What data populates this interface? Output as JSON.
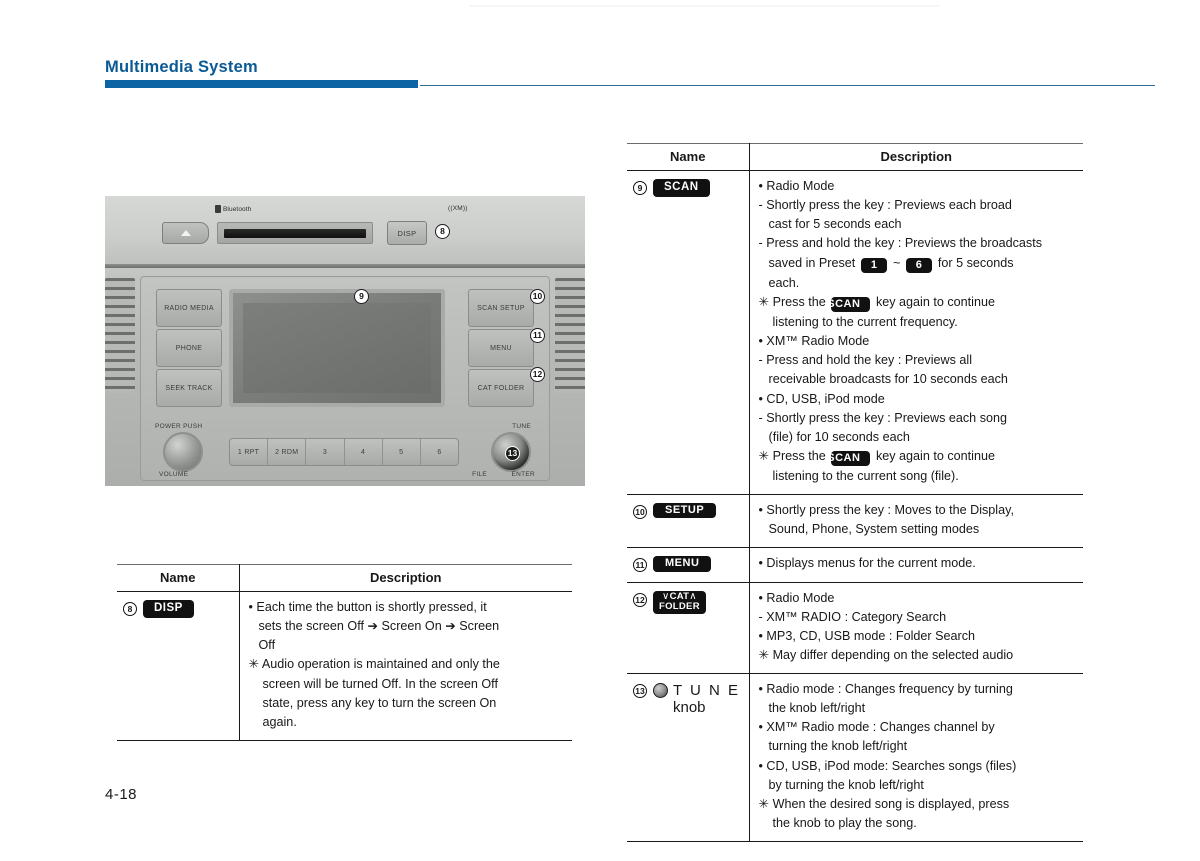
{
  "header": {
    "title": "Multimedia System"
  },
  "footer": {
    "page_number": "4-18"
  },
  "radio_photo": {
    "alt": "car-audio-head-unit-photo",
    "bluetooth_label": "Bluetooth",
    "xm_label": "((XM))",
    "eject_label": "eject-triangle",
    "disp_label": "DISP",
    "left_buttons": [
      "RADIO MEDIA",
      "PHONE",
      "SEEK TRACK"
    ],
    "right_buttons": [
      "SCAN SETUP",
      "MENU",
      "CAT FOLDER"
    ],
    "presets": [
      "1 RPT",
      "2 RDM",
      "3",
      "4",
      "5",
      "6"
    ],
    "power_label": "POWER PUSH",
    "volume_label": "VOLUME",
    "tune_label": "TUNE",
    "file_label": "FILE",
    "enter_label": "ENTER",
    "callouts": [
      "8",
      "9",
      "10",
      "11",
      "12",
      "13"
    ]
  },
  "table_left": {
    "columns": {
      "name": "Name",
      "description": "Description"
    },
    "rows": [
      {
        "num": "8",
        "badge": "DISP",
        "lines": [
          {
            "kind": "bullet",
            "text": "Each time the button is shortly pressed, it"
          },
          {
            "kind": "cont",
            "text": "sets the screen Off ➔ Screen On ➔ Screen"
          },
          {
            "kind": "cont",
            "text": "Off"
          },
          {
            "kind": "star",
            "text": "Audio operation is maintained and only the"
          },
          {
            "kind": "cont2",
            "text": "screen will be turned Off. In the screen Off"
          },
          {
            "kind": "cont2",
            "text": "state, press any key to turn the screen On"
          },
          {
            "kind": "cont2",
            "text": "again."
          }
        ]
      }
    ]
  },
  "table_right": {
    "columns": {
      "name": "Name",
      "description": "Description"
    },
    "rows": [
      {
        "num": "9",
        "badge": "SCAN",
        "lines": [
          {
            "kind": "bullet",
            "text": "Radio Mode"
          },
          {
            "kind": "dash",
            "text": "Shortly press the key : Previews each broad"
          },
          {
            "kind": "cont",
            "text": "cast for 5 seconds each"
          },
          {
            "kind": "dash",
            "text": "Press and hold the key : Previews the broadcasts"
          },
          {
            "kind": "preset",
            "pre": "saved in Preset",
            "k1": "1",
            "tilde": "~",
            "k2": "6",
            "post": "for 5 seconds"
          },
          {
            "kind": "cont",
            "text": "each."
          },
          {
            "kind": "starkey",
            "pre": "Press the",
            "key": "SCAN",
            "post": "key again to continue"
          },
          {
            "kind": "cont2",
            "text": "listening to the current frequency."
          },
          {
            "kind": "bullet",
            "text": "XM™ Radio Mode"
          },
          {
            "kind": "dash",
            "text": "Press and hold the key : Previews all"
          },
          {
            "kind": "cont",
            "text": "receivable broadcasts for 10 seconds each"
          },
          {
            "kind": "bullet",
            "text": "CD, USB, iPod mode"
          },
          {
            "kind": "dash",
            "text": "Shortly press the key : Previews each song"
          },
          {
            "kind": "cont",
            "text": "(file) for 10 seconds each"
          },
          {
            "kind": "starkey",
            "pre": "Press the",
            "key": "SCAN",
            "post": "key again to continue"
          },
          {
            "kind": "cont2",
            "text": "listening to the current song (file)."
          }
        ]
      },
      {
        "num": "10",
        "badge": "SETUP",
        "lines": [
          {
            "kind": "bullet",
            "text": "Shortly press the key : Moves to the Display,"
          },
          {
            "kind": "cont",
            "text": "Sound, Phone, System setting modes"
          }
        ]
      },
      {
        "num": "11",
        "badge": "MENU",
        "lines": [
          {
            "kind": "bullet",
            "text": "Displays menus for the current mode."
          }
        ]
      },
      {
        "num": "12",
        "badge_two": {
          "line1": "CAT",
          "line2": "FOLDER",
          "left_chevron": "∨",
          "right_chevron": "∧"
        },
        "lines": [
          {
            "kind": "bullet",
            "text": "Radio Mode"
          },
          {
            "kind": "dash",
            "text": "XM™ RADIO : Category Search"
          },
          {
            "kind": "bullet",
            "text": "MP3, CD, USB mode : Folder Search"
          },
          {
            "kind": "star",
            "text": "May differ depending on the selected audio"
          }
        ]
      },
      {
        "num": "13",
        "tune": {
          "icon": "knob-icon",
          "label": "T U N E",
          "sublabel": "knob"
        },
        "lines": [
          {
            "kind": "bullet",
            "text": "Radio mode : Changes frequency by turning"
          },
          {
            "kind": "cont",
            "text": "the knob left/right"
          },
          {
            "kind": "bullet",
            "text": "XM™ Radio mode : Changes channel by"
          },
          {
            "kind": "cont",
            "text": "turning the knob left/right"
          },
          {
            "kind": "bullet",
            "text": "CD, USB, iPod mode: Searches songs (files)"
          },
          {
            "kind": "cont",
            "text": "by turning the knob left/right"
          },
          {
            "kind": "star",
            "text": "When the desired song is displayed, press"
          },
          {
            "kind": "cont2",
            "text": "the knob to play the song."
          }
        ]
      }
    ]
  },
  "colors": {
    "header_blue": "#0d64a4",
    "title_blue": "#0a5a96",
    "badge_black": "#111111"
  }
}
